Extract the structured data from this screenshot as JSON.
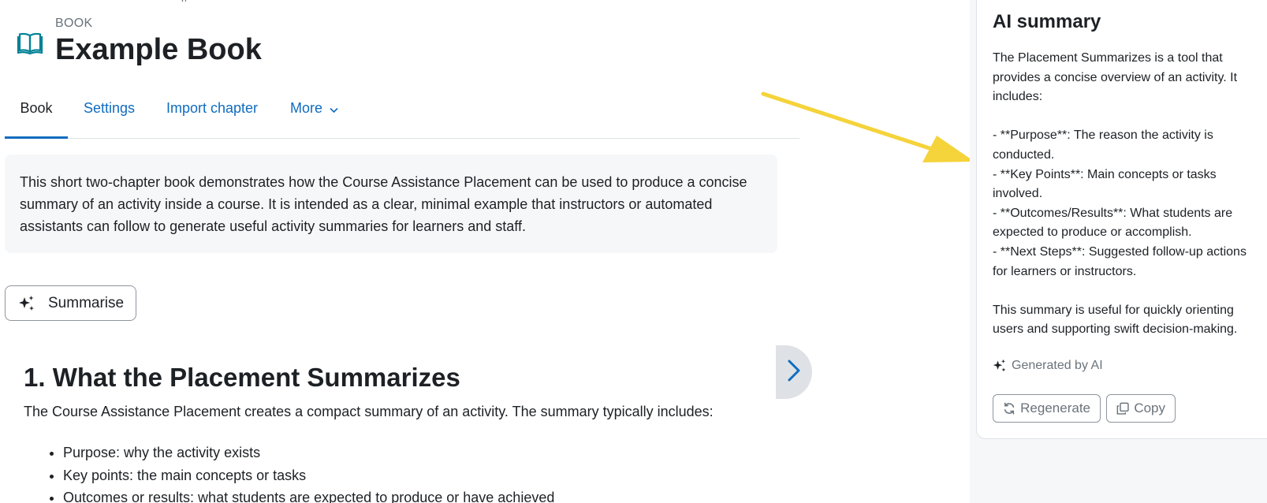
{
  "header": {
    "module_type": "BOOK",
    "title": "Example Book",
    "icon": "book-icon"
  },
  "tabs": [
    {
      "label": "Book",
      "active": true
    },
    {
      "label": "Settings",
      "active": false
    },
    {
      "label": "Import chapter",
      "active": false
    },
    {
      "label": "More",
      "active": false,
      "icon": "chevron-down-icon"
    }
  ],
  "intro": {
    "text": "This short two-chapter book demonstrates how the Course Assistance Placement can be used to produce a concise summary of an activity inside a course. It is intended as a clear, minimal example that instructors or automated assistants can follow to generate useful activity summaries for learners and staff."
  },
  "summarise_button": {
    "label": "Summarise",
    "icon": "sparkle-icon"
  },
  "next_chapter": {
    "icon": "chevron-right-icon"
  },
  "chapter": {
    "title": "1. What the Placement Summarizes",
    "text": "The Course Assistance Placement creates a compact summary of an activity. The summary typically includes:",
    "items": [
      "Purpose: why the activity exists",
      "Key points: the main concepts or tasks",
      "Outcomes or results: what students are expected to produce or have achieved"
    ]
  },
  "ai_drawer": {
    "title": "AI summary",
    "intro": "The Placement Summarizes is a tool that provides a concise overview of an activity. It includes:",
    "points": [
      "- **Purpose**: The reason the activity is conducted.",
      "- **Key Points**: Main concepts or tasks involved.",
      "- **Outcomes/Results**: What students are expected to produce or accomplish.",
      "- **Next Steps**: Suggested follow-up actions for learners or instructors."
    ],
    "closing": "This summary is useful for quickly orienting users and supporting swift decision-making.",
    "generated_label": "Generated by AI",
    "regenerate_label": "Regenerate",
    "copy_label": "Copy"
  },
  "colors": {
    "link": "#0f6cbf",
    "text": "#1d2125",
    "muted": "#6a737b",
    "intro_bg": "#f6f7f9",
    "annotation_arrow": "#f5d33a",
    "book_icon": "#008196"
  }
}
